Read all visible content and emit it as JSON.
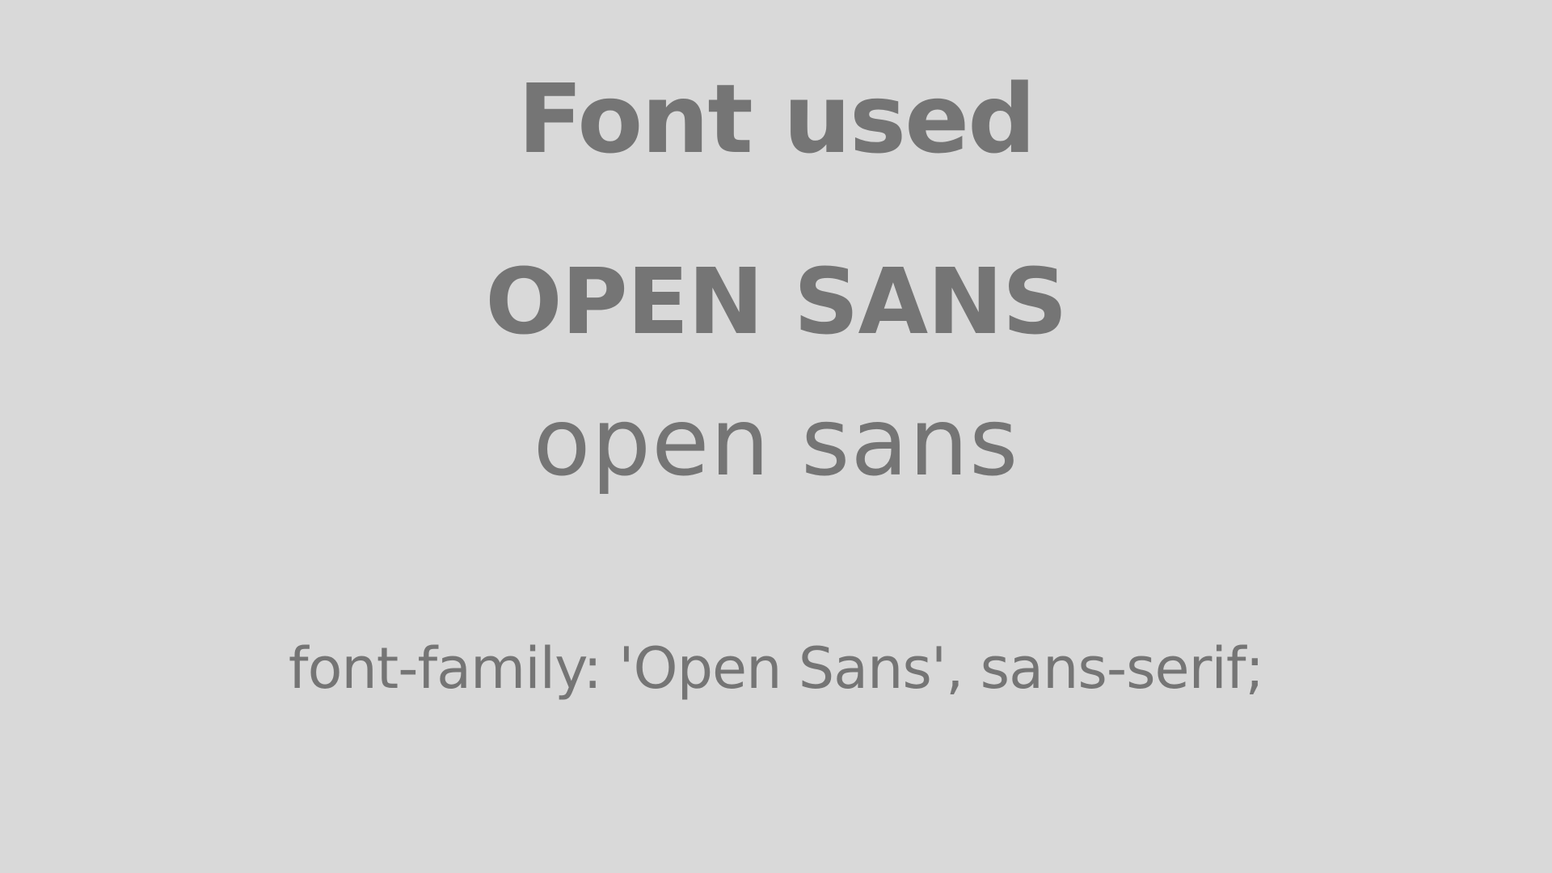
{
  "slide": {
    "heading": "Font used",
    "font_name_upper": "OPEN SANS",
    "font_name_lower": "open sans",
    "css_declaration": "font-family: 'Open Sans', sans-serif;"
  },
  "colors": {
    "background": "#d9d9d9",
    "text": "#757575"
  }
}
